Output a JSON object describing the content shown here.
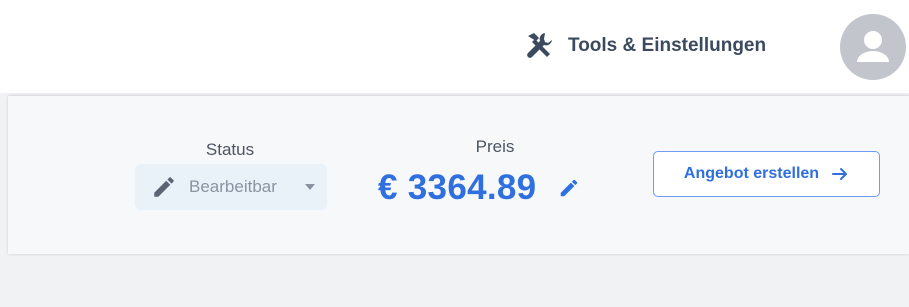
{
  "header": {
    "tools_label": "Tools & Einstellungen",
    "tools_icon": "tools-icon",
    "avatar_icon": "user-avatar-icon"
  },
  "panel": {
    "status": {
      "label": "Status",
      "value": "Bearbeitbar",
      "icon": "pencil-icon"
    },
    "price": {
      "label": "Preis",
      "value": "€ 3364.89",
      "edit_icon": "pencil-icon"
    },
    "offer_button": {
      "label": "Angebot erstellen",
      "icon": "arrow-right-icon"
    }
  },
  "colors": {
    "accent": "#2f6fe0",
    "header_text": "#3c4a60",
    "muted": "#8a93a0",
    "select_bg": "#e9f1f9",
    "avatar_bg": "#c2c5cc"
  }
}
